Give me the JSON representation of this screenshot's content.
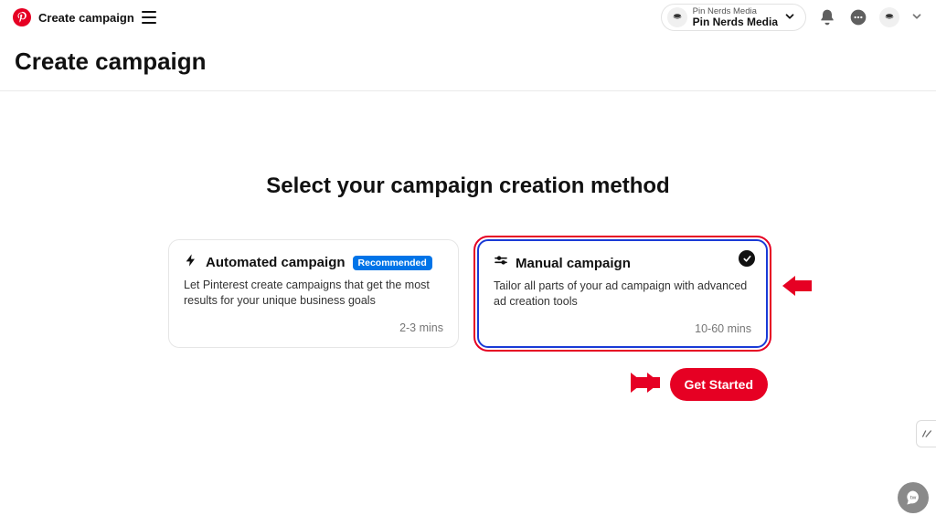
{
  "header": {
    "breadcrumb": "Create campaign",
    "account": {
      "org": "Pin Nerds Media",
      "name": "Pin Nerds Media"
    }
  },
  "page": {
    "title": "Create campaign"
  },
  "main": {
    "heading": "Select your campaign creation method",
    "cards": {
      "automated": {
        "title": "Automated campaign",
        "badge": "Recommended",
        "description": "Let Pinterest create campaigns that get the most results for your unique business goals",
        "time": "2-3 mins"
      },
      "manual": {
        "title": "Manual campaign",
        "description": "Tailor all parts of your ad campaign with advanced ad creation tools",
        "time": "10-60 mins"
      }
    },
    "cta": "Get Started"
  }
}
